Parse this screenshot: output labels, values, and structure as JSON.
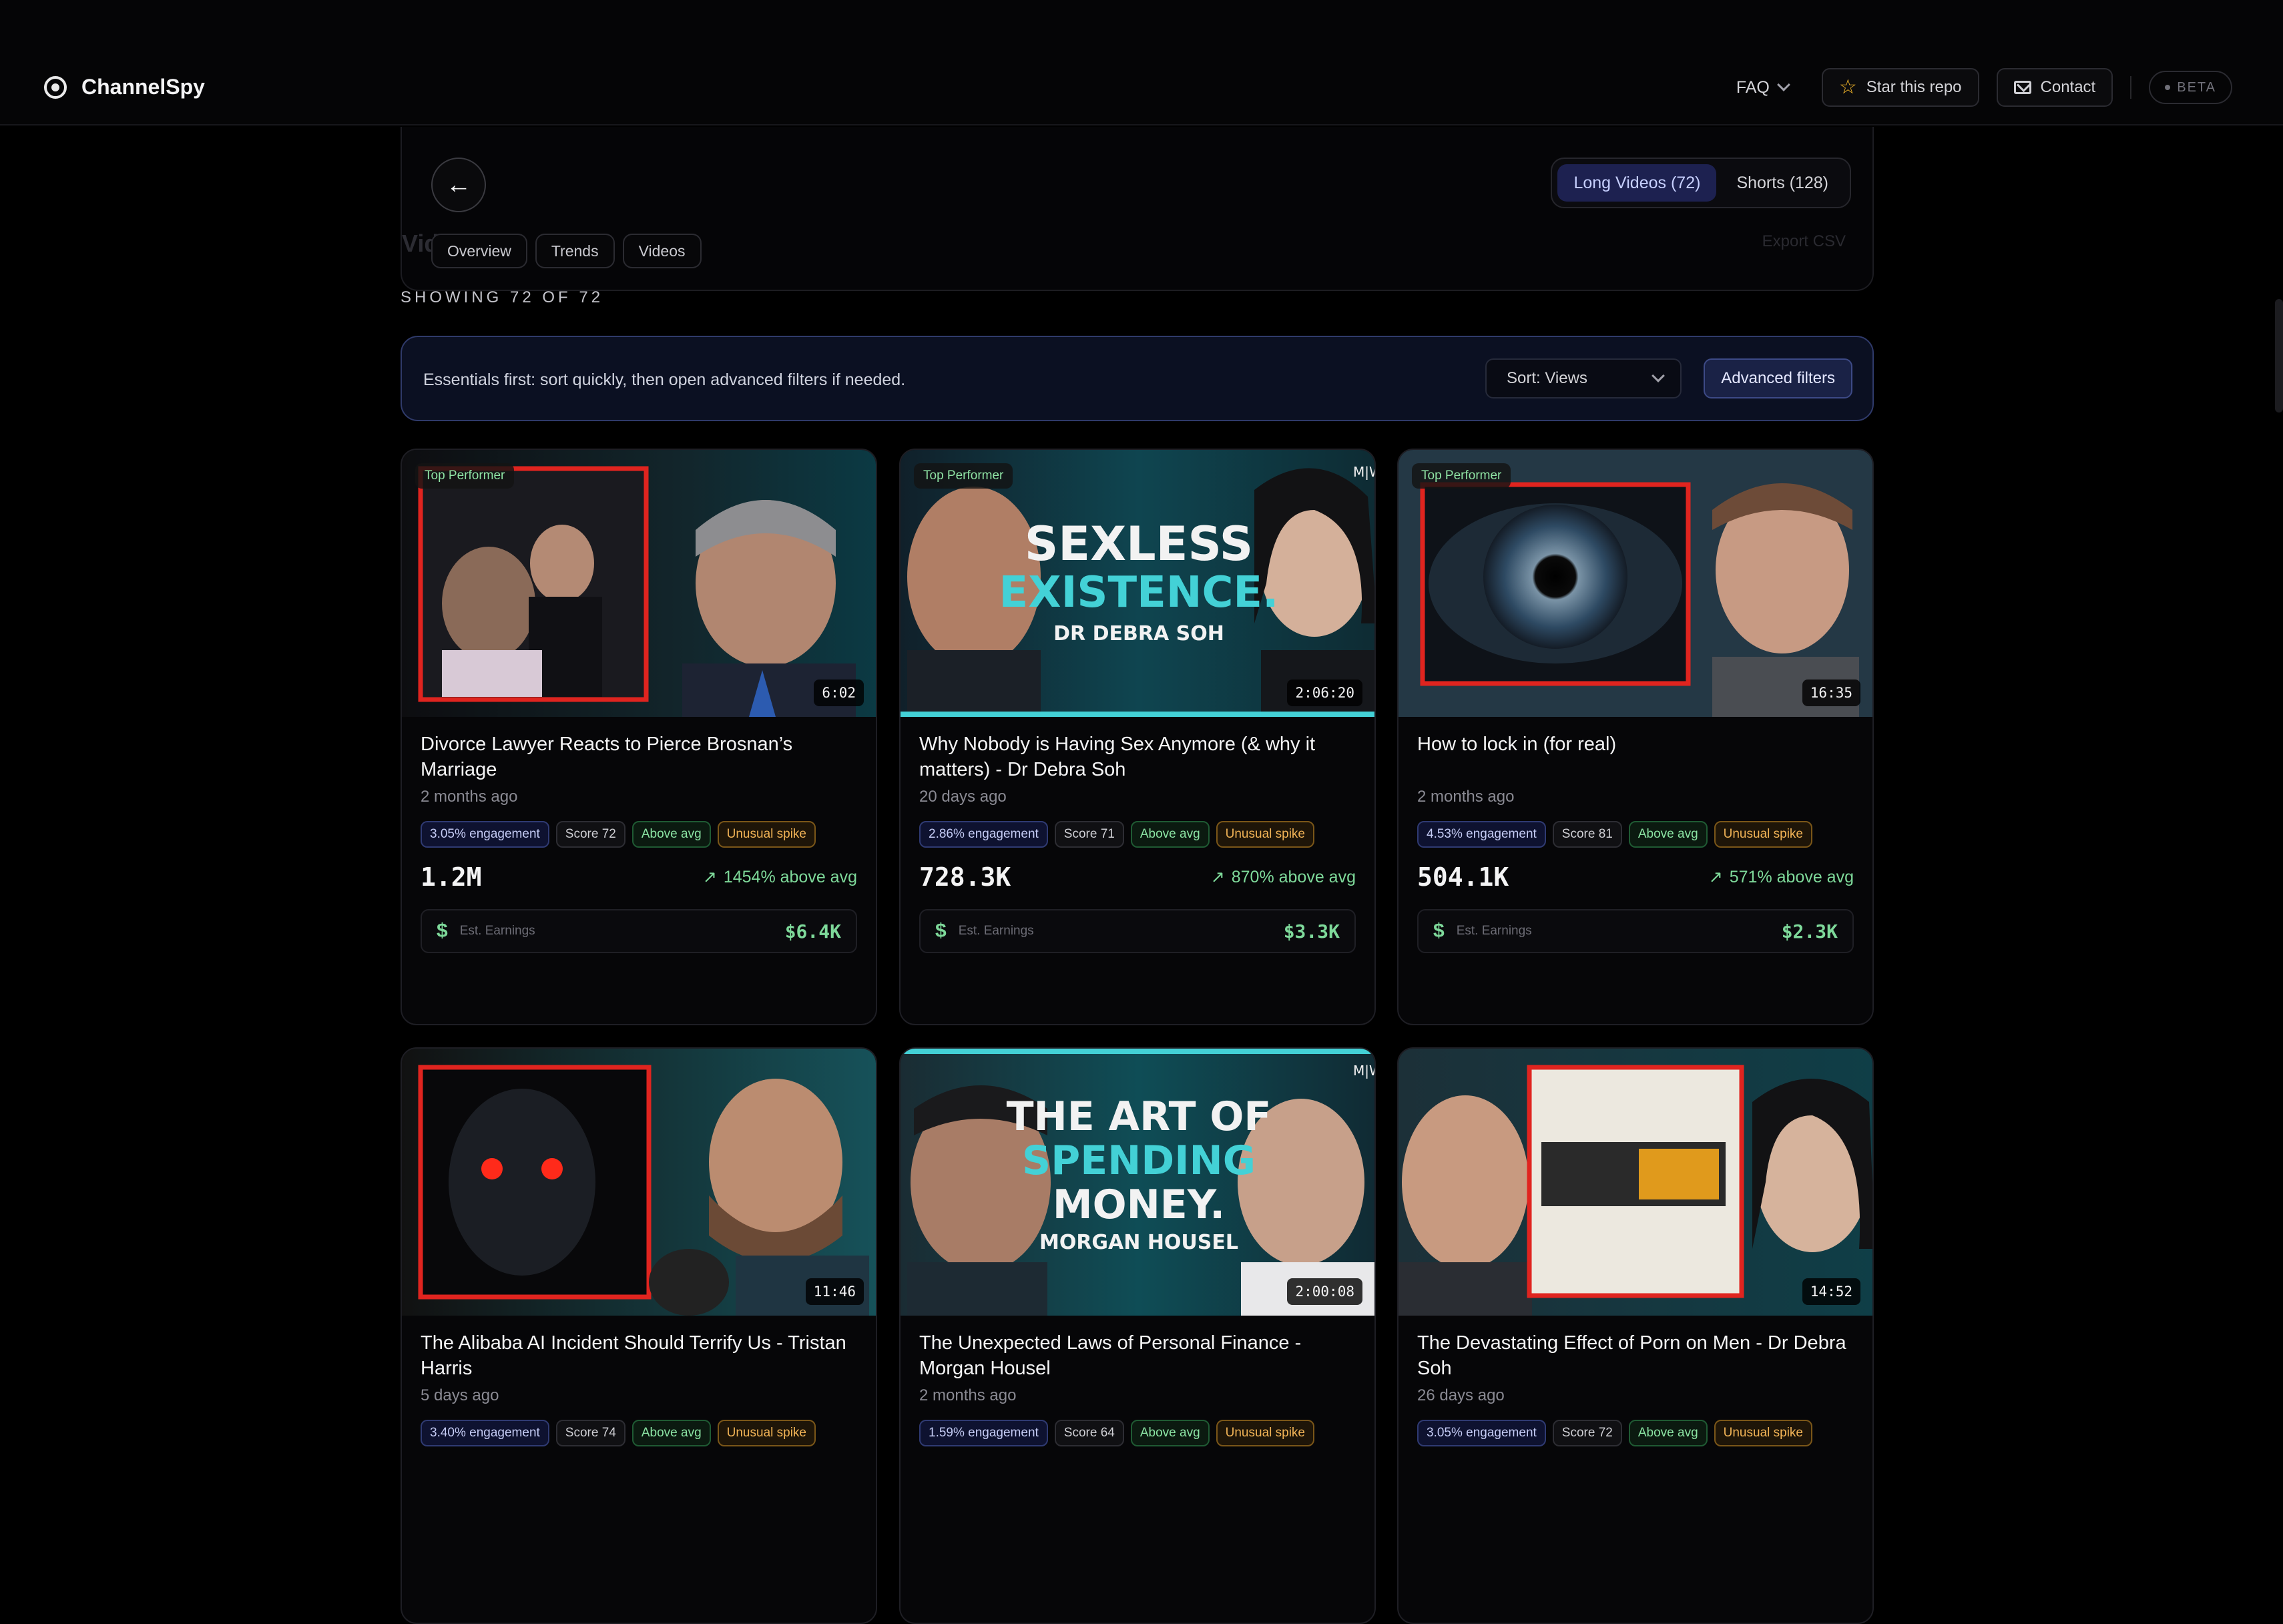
{
  "header": {
    "brand": "ChannelSpy",
    "faq": "FAQ",
    "star_label": "Star this repo",
    "contact_label": "Contact",
    "beta_label": "BETA"
  },
  "panel": {
    "tabs": [
      "Overview",
      "Trends",
      "Videos"
    ],
    "ghost_title": "Videos",
    "ghost_export": "Export CSV",
    "segments": [
      {
        "label": "Long Videos (72)",
        "active": true
      },
      {
        "label": "Shorts (128)",
        "active": false
      }
    ]
  },
  "showing": "SHOWING 72 OF 72",
  "filter": {
    "hint": "Essentials first: sort quickly, then open advanced filters if needed.",
    "sort_value": "Sort: Views",
    "advanced_label": "Advanced filters"
  },
  "colors": {
    "accent": "#1d2150",
    "positive": "#7ed99a",
    "warning": "#f1b356"
  },
  "videos": [
    {
      "badge": "Top Performer",
      "duration": "6:02",
      "title": "Divorce Lawyer Reacts to Pierce Brosnan’s Marriage",
      "age": "2 months ago",
      "engagement": "3.05% engagement",
      "score": "Score 72",
      "above": "Above avg",
      "spike": "Unusual spike",
      "views": "1.2M",
      "delta": "1454% above avg",
      "earn_label": "Est. Earnings",
      "earnings": "$6.4K",
      "thumb_text": "",
      "thumb_sub": ""
    },
    {
      "badge": "Top Performer",
      "duration": "2:06:20",
      "title": "Why Nobody is Having Sex Anymore (& why it matters) - Dr Debra Soh",
      "age": "20 days ago",
      "engagement": "2.86% engagement",
      "score": "Score 71",
      "above": "Above avg",
      "spike": "Unusual spike",
      "views": "728.3K",
      "delta": "870% above avg",
      "earn_label": "Est. Earnings",
      "earnings": "$3.3K",
      "thumb_text": "SEXLESS",
      "thumb_text2": "EXISTENCE.",
      "thumb_sub": "DR DEBRA SOH"
    },
    {
      "badge": "Top Performer",
      "duration": "16:35",
      "title": "How to lock in (for real)",
      "age": "2 months ago",
      "engagement": "4.53% engagement",
      "score": "Score 81",
      "above": "Above avg",
      "spike": "Unusual spike",
      "views": "504.1K",
      "delta": "571% above avg",
      "earn_label": "Est. Earnings",
      "earnings": "$2.3K",
      "thumb_text": "",
      "thumb_sub": ""
    },
    {
      "badge": "",
      "duration": "11:46",
      "title": "The Alibaba AI Incident Should Terrify Us - Tristan Harris",
      "age": "5 days ago",
      "engagement": "3.40% engagement",
      "score": "Score 74",
      "above": "Above avg",
      "spike": "Unusual spike",
      "views": "",
      "delta": "",
      "earn_label": "",
      "earnings": ""
    },
    {
      "badge": "",
      "duration": "2:00:08",
      "title": "The Unexpected Laws of Personal Finance - Morgan Housel",
      "age": "2 months ago",
      "engagement": "1.59% engagement",
      "score": "Score 64",
      "above": "Above avg",
      "spike": "Unusual spike",
      "views": "",
      "delta": "",
      "earn_label": "",
      "earnings": "",
      "thumb_text": "THE ART OF",
      "thumb_text2": "SPENDING",
      "thumb_text3": "MONEY.",
      "thumb_sub": "MORGAN HOUSEL"
    },
    {
      "badge": "",
      "duration": "14:52",
      "title": "The Devastating Effect of Porn on Men - Dr Debra Soh",
      "age": "26 days ago",
      "engagement": "3.05% engagement",
      "score": "Score 72",
      "above": "Above avg",
      "spike": "Unusual spike",
      "views": "",
      "delta": "",
      "earn_label": "",
      "earnings": ""
    }
  ]
}
